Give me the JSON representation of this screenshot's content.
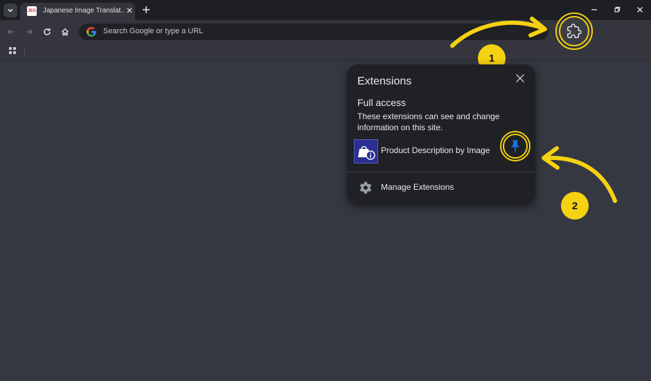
{
  "browser": {
    "tab": {
      "title": "Japanese Image Translat...",
      "favicon_text": "JEG"
    },
    "omnibox": {
      "placeholder": "Search Google or type a URL"
    }
  },
  "popup": {
    "title": "Extensions",
    "section_title": "Full access",
    "section_desc": "These extensions can see and change information on this site.",
    "extension_name": "Product Description by Image",
    "manage_label": "Manage Extensions"
  },
  "annotations": {
    "step1": "1",
    "step2": "2",
    "highlight_color": "#f5d211"
  },
  "icons": {
    "tab_search": "chevron-down-icon",
    "close": "close-icon",
    "new_tab": "plus-icon",
    "back": "arrow-left-icon",
    "forward": "arrow-right-icon",
    "reload": "reload-icon",
    "home": "home-icon",
    "extensions": "puzzle-icon",
    "pin": "pin-icon",
    "settings": "gear-icon",
    "apps": "apps-grid-icon"
  }
}
